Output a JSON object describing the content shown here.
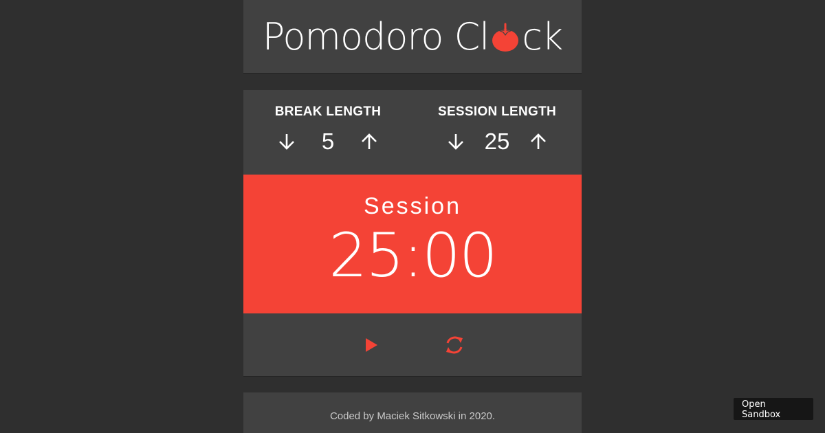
{
  "header": {
    "title_part1": "Pomodoro Cl",
    "title_part2": "ck",
    "logo_icon": "tomato-icon"
  },
  "break": {
    "label": "BREAK LENGTH",
    "value": "5",
    "decrement_icon": "arrow-down-icon",
    "increment_icon": "arrow-up-icon"
  },
  "session": {
    "label": "SESSION LENGTH",
    "value": "25",
    "decrement_icon": "arrow-down-icon",
    "increment_icon": "arrow-up-icon"
  },
  "timer": {
    "label": "Session",
    "time": "25:00"
  },
  "controls": {
    "play_icon": "play-icon",
    "reset_icon": "refresh-icon"
  },
  "footer": {
    "text": "Coded by Maciek Sitkowski in 2020."
  },
  "sandbox_button": {
    "label": "Open Sandbox"
  },
  "colors": {
    "accent": "#f44336",
    "background": "#2f2f2f",
    "panel": "#414141"
  }
}
